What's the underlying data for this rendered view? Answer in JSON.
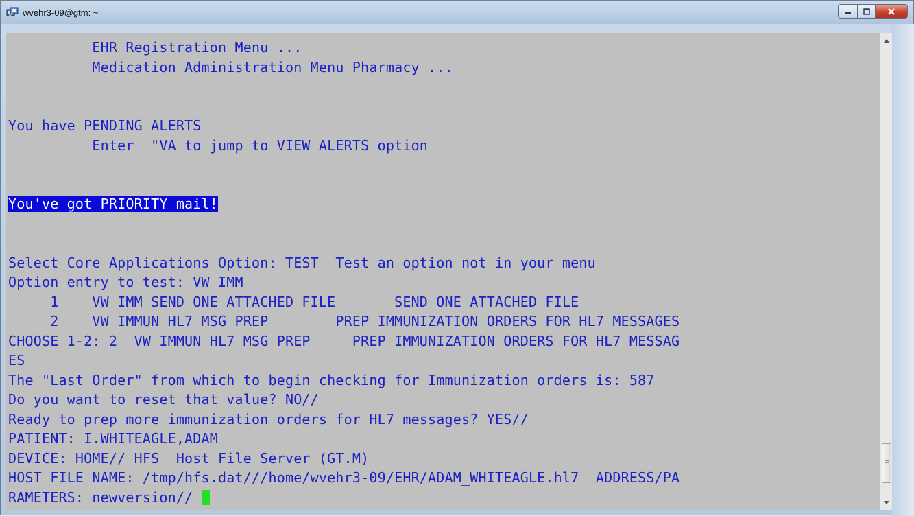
{
  "window": {
    "title": "wvehr3-09@gtm: ~",
    "app_icon": "putty-icon",
    "controls": {
      "minimize": "minimize-icon",
      "maximize": "maximize-icon",
      "close": "close-icon"
    }
  },
  "terminal": {
    "lines": [
      "          EHR Registration Menu ...",
      "          Medication Administration Menu Pharmacy ...",
      "",
      "",
      "You have PENDING ALERTS",
      "          Enter  \"VA to jump to VIEW ALERTS option",
      "",
      "",
      "You've got PRIORITY mail!",
      "",
      "",
      "Select Core Applications Option: TEST  Test an option not in your menu",
      "Option entry to test: VW IMM",
      "     1    VW IMM SEND ONE ATTACHED FILE       SEND ONE ATTACHED FILE",
      "     2    VW IMMUN HL7 MSG PREP        PREP IMMUNIZATION ORDERS FOR HL7 MESSAGES",
      "CHOOSE 1-2: 2  VW IMMUN HL7 MSG PREP     PREP IMMUNIZATION ORDERS FOR HL7 MESSAG",
      "ES",
      "The \"Last Order\" from which to begin checking for Immunization orders is: 587",
      "Do you want to reset that value? NO//",
      "Ready to prep more immunization orders for HL7 messages? YES//",
      "PATIENT: I.WHITEAGLE,ADAM",
      "DEVICE: HOME// HFS  Host File Server (GT.M)",
      "HOST FILE NAME: /tmp/hfs.dat///home/wvehr3-09/EHR/ADAM_WHITEAGLE.hl7  ADDRESS/PA",
      "RAMETERS: newversion// "
    ],
    "highlighted_line": 8,
    "prompt_line": 23,
    "colors": {
      "background": "#c0c0c0",
      "text": "#1b22c4",
      "highlight_bg": "#0a0ad8",
      "highlight_text": "#ffffff",
      "cursor": "#22e022"
    }
  }
}
